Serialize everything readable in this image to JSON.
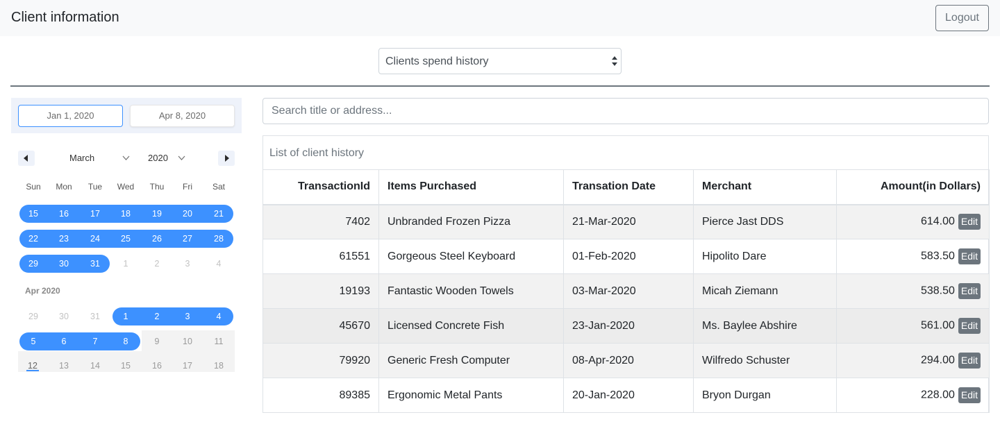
{
  "header": {
    "title": "Client information",
    "logout_label": "Logout"
  },
  "view_select": {
    "value": "Clients spend history"
  },
  "date_range": {
    "start": "Jan 1, 2020",
    "end": "Apr 8, 2020"
  },
  "calendar": {
    "month": "March",
    "year": "2020",
    "weekdays": [
      "Sun",
      "Mon",
      "Tue",
      "Wed",
      "Thu",
      "Fri",
      "Sat"
    ],
    "march_rows": [
      [
        "15",
        "16",
        "17",
        "18",
        "19",
        "20",
        "21"
      ],
      [
        "22",
        "23",
        "24",
        "25",
        "26",
        "27",
        "28"
      ],
      [
        "29",
        "30",
        "31",
        "1",
        "2",
        "3",
        "4"
      ]
    ],
    "april_label": "Apr 2020",
    "april_rows": [
      [
        "29",
        "30",
        "31",
        "1",
        "2",
        "3",
        "4"
      ],
      [
        "5",
        "6",
        "7",
        "8",
        "9",
        "10",
        "11"
      ],
      [
        "12",
        "13",
        "14",
        "15",
        "16",
        "17",
        "18"
      ]
    ]
  },
  "search": {
    "placeholder": "Search title or address..."
  },
  "history": {
    "heading": "List of client history",
    "columns": [
      "TransactionId",
      "Items Purchased",
      "Transation Date",
      "Merchant",
      "Amount(in Dollars)"
    ],
    "edit_label": "Edit",
    "rows": [
      {
        "id": "7402",
        "item": "Unbranded Frozen Pizza",
        "date": "21-Mar-2020",
        "merchant": "Pierce Jast DDS",
        "amount": "614.00"
      },
      {
        "id": "61551",
        "item": "Gorgeous Steel Keyboard",
        "date": "01-Feb-2020",
        "merchant": "Hipolito Dare",
        "amount": "583.50"
      },
      {
        "id": "19193",
        "item": "Fantastic Wooden Towels",
        "date": "03-Mar-2020",
        "merchant": "Micah Ziemann",
        "amount": "538.50"
      },
      {
        "id": "45670",
        "item": "Licensed Concrete Fish",
        "date": "23-Jan-2020",
        "merchant": "Ms. Baylee Abshire",
        "amount": "561.00"
      },
      {
        "id": "79920",
        "item": "Generic Fresh Computer",
        "date": "08-Apr-2020",
        "merchant": "Wilfredo Schuster",
        "amount": "294.00"
      },
      {
        "id": "89385",
        "item": "Ergonomic Metal Pants",
        "date": "20-Jan-2020",
        "merchant": "Bryon Durgan",
        "amount": "228.00"
      }
    ]
  }
}
